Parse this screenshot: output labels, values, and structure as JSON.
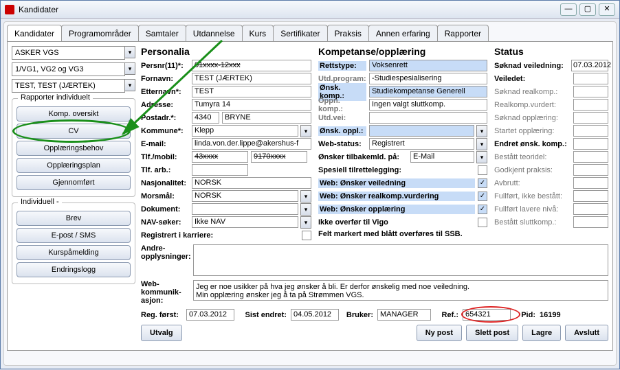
{
  "window": {
    "title": "Kandidater"
  },
  "tabs": [
    "Kandidater",
    "Programområder",
    "Samtaler",
    "Utdannelse",
    "Kurs",
    "Sertifikater",
    "Praksis",
    "Annen erfaring",
    "Rapporter"
  ],
  "dropdowns": {
    "d1": "ASKER VGS",
    "d2": "1/VG1, VG2 og VG3",
    "d3": "TEST, TEST (JÆRTEK)"
  },
  "groupRapporter": {
    "title": "Rapporter individuelt",
    "btns": {
      "komp": "Komp. oversikt",
      "cv": "CV",
      "oppl": "Opplæringsbehov",
      "plan": "Opplæringsplan",
      "gjen": "Gjennomført"
    }
  },
  "groupIndiv": {
    "title": "Individuell -",
    "btns": {
      "brev": "Brev",
      "epost": "E-post / SMS",
      "kurs": "Kurspåmelding",
      "logg": "Endringslogg"
    }
  },
  "personalia": {
    "title": "Personalia",
    "persnr_lbl": "Persnr(11)*:",
    "persnr": "01xxxx-12xxx",
    "fornavn_lbl": "Fornavn:",
    "fornavn": "TEST (JÆRTEK)",
    "etternavn_lbl": "Etternavn*:",
    "etternavn": "TEST",
    "adresse_lbl": "Adresse:",
    "adresse": "Tumyra 14",
    "postadr_lbl": "Postadr.*:",
    "postnr": "4340",
    "poststed": "BRYNE",
    "kommune_lbl": "Kommune*:",
    "kommune": "Klepp",
    "email_lbl": "E-mail:",
    "email": "linda.von.der.lippe@akershus-f",
    "tlfmobil_lbl": "Tlf./mobil:",
    "tlf": "43xxxx",
    "mobil": "9170xxxx",
    "tlfarb_lbl": "Tlf. arb.:",
    "tlfarb": "",
    "nasj_lbl": "Nasjonalitet:",
    "nasj": "NORSK",
    "morsmal_lbl": "Morsmål:",
    "morsmal": "NORSK",
    "dokument_lbl": "Dokument:",
    "dokument": "",
    "nav_lbl": "NAV-søker:",
    "nav": "Ikke NAV",
    "regkarr_lbl": "Registrert i karriere:"
  },
  "kompetanse": {
    "title": "Kompetanse/opplæring",
    "rettstype_lbl": "Rettstype:",
    "rettstype": "Voksenrett",
    "utdprog_lbl": "Utd.program:",
    "utdprog": "-Studiespesialisering",
    "onskkomp_lbl": "Ønsk. komp.:",
    "onskkomp": "Studiekompetanse Generell",
    "oppnkomp_lbl": "Oppn. komp.:",
    "oppnkomp": "Ingen valgt sluttkomp.",
    "utdvei_lbl": "Utd.vei:",
    "utdvei": "",
    "onskoppl_lbl": "Ønsk. oppl.:",
    "onskoppl": "",
    "webstatus_lbl": "Web-status:",
    "webstatus": "Registrert",
    "tilbakemld_lbl": "Ønsker tilbakemld. på:",
    "tilbakemld": "E-Mail",
    "spesiell_lbl": "Spesiell tilrettelegging:",
    "webveil_lbl": "Web: Ønsker veiledning",
    "webreal_lbl": "Web: Ønsker realkomp.vurdering",
    "weboppl_lbl": "Web: Ønsker opplæring",
    "vigo_lbl": "Ikke overfør til Vigo",
    "ssbnote": "Felt markert med blått overføres til SSB."
  },
  "status": {
    "title": "Status",
    "rows": [
      {
        "label": "Søknad veiledning:",
        "value": "07.03.2012",
        "active": true
      },
      {
        "label": "Veiledet:",
        "value": "",
        "active": true
      },
      {
        "label": "Søknad realkomp.:",
        "value": "",
        "active": false
      },
      {
        "label": "Realkomp.vurdert:",
        "value": "",
        "active": false
      },
      {
        "label": "Søknad opplæring:",
        "value": "",
        "active": false
      },
      {
        "label": "Startet opplæring:",
        "value": "",
        "active": false
      },
      {
        "label": "Endret ønsk. komp.:",
        "value": "",
        "active": true
      },
      {
        "label": "Bestått teoridel:",
        "value": "",
        "active": false
      },
      {
        "label": "Godkjent praksis:",
        "value": "",
        "active": false
      },
      {
        "label": "Avbrutt:",
        "value": "",
        "active": false
      },
      {
        "label": "Fullført, ikke bestått:",
        "value": "",
        "active": false
      },
      {
        "label": "Fullført lavere nivå:",
        "value": "",
        "active": false
      },
      {
        "label": "Bestått sluttkomp.:",
        "value": "",
        "active": false
      }
    ]
  },
  "andre": {
    "lbl": "Andre-\nopplysninger:",
    "text": ""
  },
  "webkomm": {
    "lbl": "Web-\nkommunik-\nasjon:",
    "text": "Jeg er noe usikker på hva jeg ønsker å bli. Er derfor ønskelig med noe veiledning.\nMin opplæring ønsker jeg å ta på Strømmen VGS."
  },
  "regrow": {
    "regforst_lbl": "Reg. først:",
    "regforst": "07.03.2012",
    "sistendret_lbl": "Sist endret:",
    "sistendret": "04.05.2012",
    "bruker_lbl": "Bruker:",
    "bruker": "MANAGER",
    "ref_lbl": "Ref.:",
    "ref": "654321",
    "pid_lbl": "Pid:",
    "pid": "16199"
  },
  "footer": {
    "utvalg": "Utvalg",
    "nypost": "Ny post",
    "slett": "Slett post",
    "lagre": "Lagre",
    "avslutt": "Avslutt"
  }
}
